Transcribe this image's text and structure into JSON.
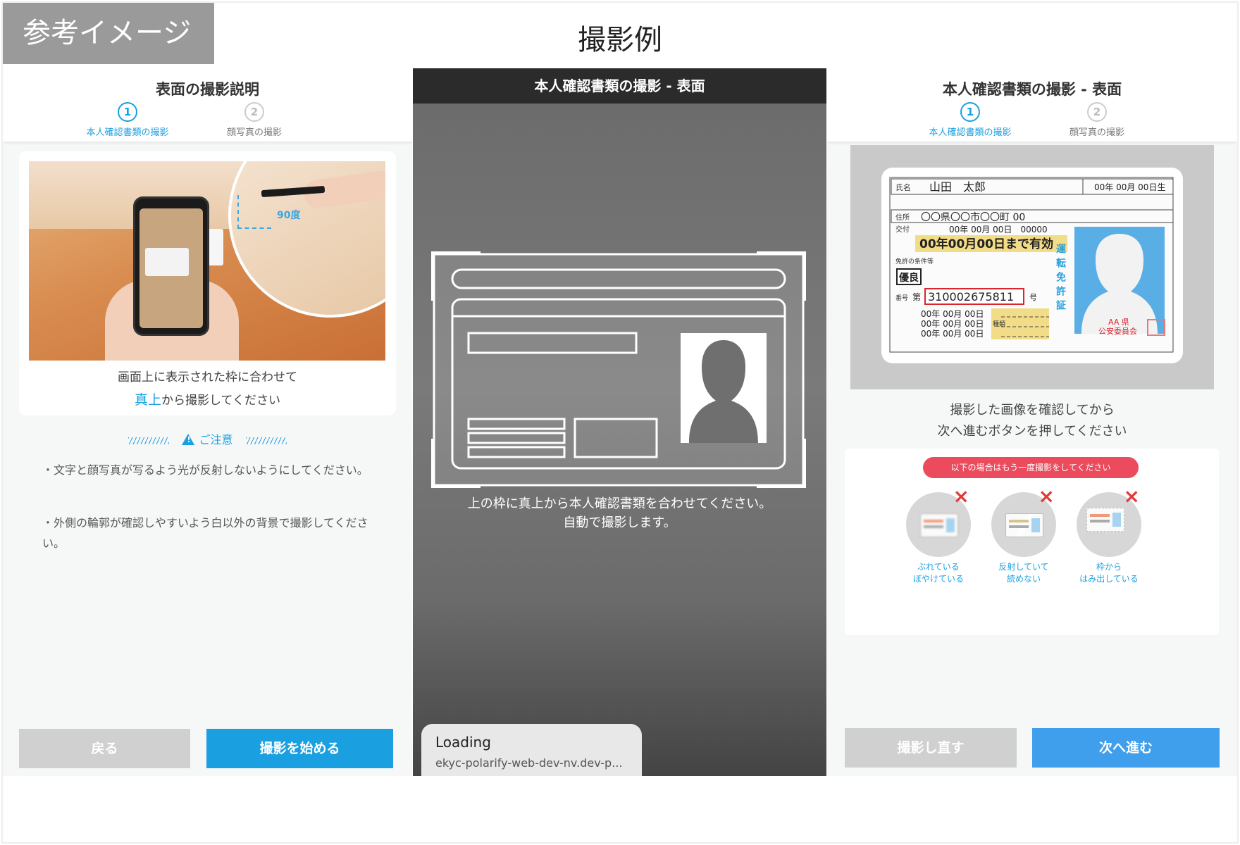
{
  "reference_badge": "参考イメージ",
  "main_title": "撮影例",
  "panel1": {
    "title": "表面の撮影説明",
    "steps": [
      {
        "num": "1",
        "label": "本人確認書類の撮影"
      },
      {
        "num": "2",
        "label": "顔写真の撮影"
      }
    ],
    "photo_degree_label": "90度",
    "instruction_line1": "画面上に表示された枠に合わせて",
    "instruction_emphasis": "真上",
    "instruction_line2_rest": "から撮影してください",
    "notice_title": "ご注意",
    "notes": [
      "・文字と顔写真が写るよう光が反射しないようにしてください。",
      "・外側の輪郭が確認しやすいよう白以外の背景で撮影してください。"
    ],
    "back_button": "戻る",
    "start_button": "撮影を始める"
  },
  "panel2": {
    "title": "本人確認書類の撮影 - 表面",
    "guide_text_line1": "上の枠に真上から本人確認書類を合わせてください。",
    "guide_text_line2": "自動で撮影します。",
    "loading_title": "Loading",
    "loading_url": "ekyc-polarify-web-dev-nv.dev-p..."
  },
  "panel3": {
    "title": "本人確認書類の撮影 - 表面",
    "steps": [
      {
        "num": "1",
        "label": "本人確認書類の撮影"
      },
      {
        "num": "2",
        "label": "顔写真の撮影"
      }
    ],
    "license": {
      "name_label": "氏名",
      "name": "山田　太郎",
      "birth": "00年 00月 00日生",
      "address_label": "住所",
      "address": "〇〇県〇〇市〇〇町 00",
      "issue_label": "交付",
      "issue": "00年 00月 00日　00000",
      "expiry": "00年00月00日まで有効",
      "condition_label": "免許の条件等",
      "excellent": "優良",
      "number_label": "番号",
      "number_prefix": "第",
      "number": "310002675811",
      "number_suffix": "号",
      "date_row1": "00年 00月 00日",
      "date_row2": "00年 00月 00日",
      "date_row3": "00年 00月 00日",
      "type_label": "種類",
      "vertical_label": "運転免許証",
      "authority_line1": "AA 県",
      "authority_line2": "公安委員会"
    },
    "confirm_line1": "撮影した画像を確認してから",
    "confirm_line2": "次へ進むボタンを押してください",
    "retake_notice": "以下の場合はもう一度撮影をしてください",
    "examples": [
      {
        "line1": "ぶれている",
        "line2": "ぼやけている"
      },
      {
        "line1": "反射していて",
        "line2": "読めない"
      },
      {
        "line1": "枠から",
        "line2": "はみ出している"
      }
    ],
    "retake_button": "撮影し直す",
    "next_button": "次へ進む"
  }
}
